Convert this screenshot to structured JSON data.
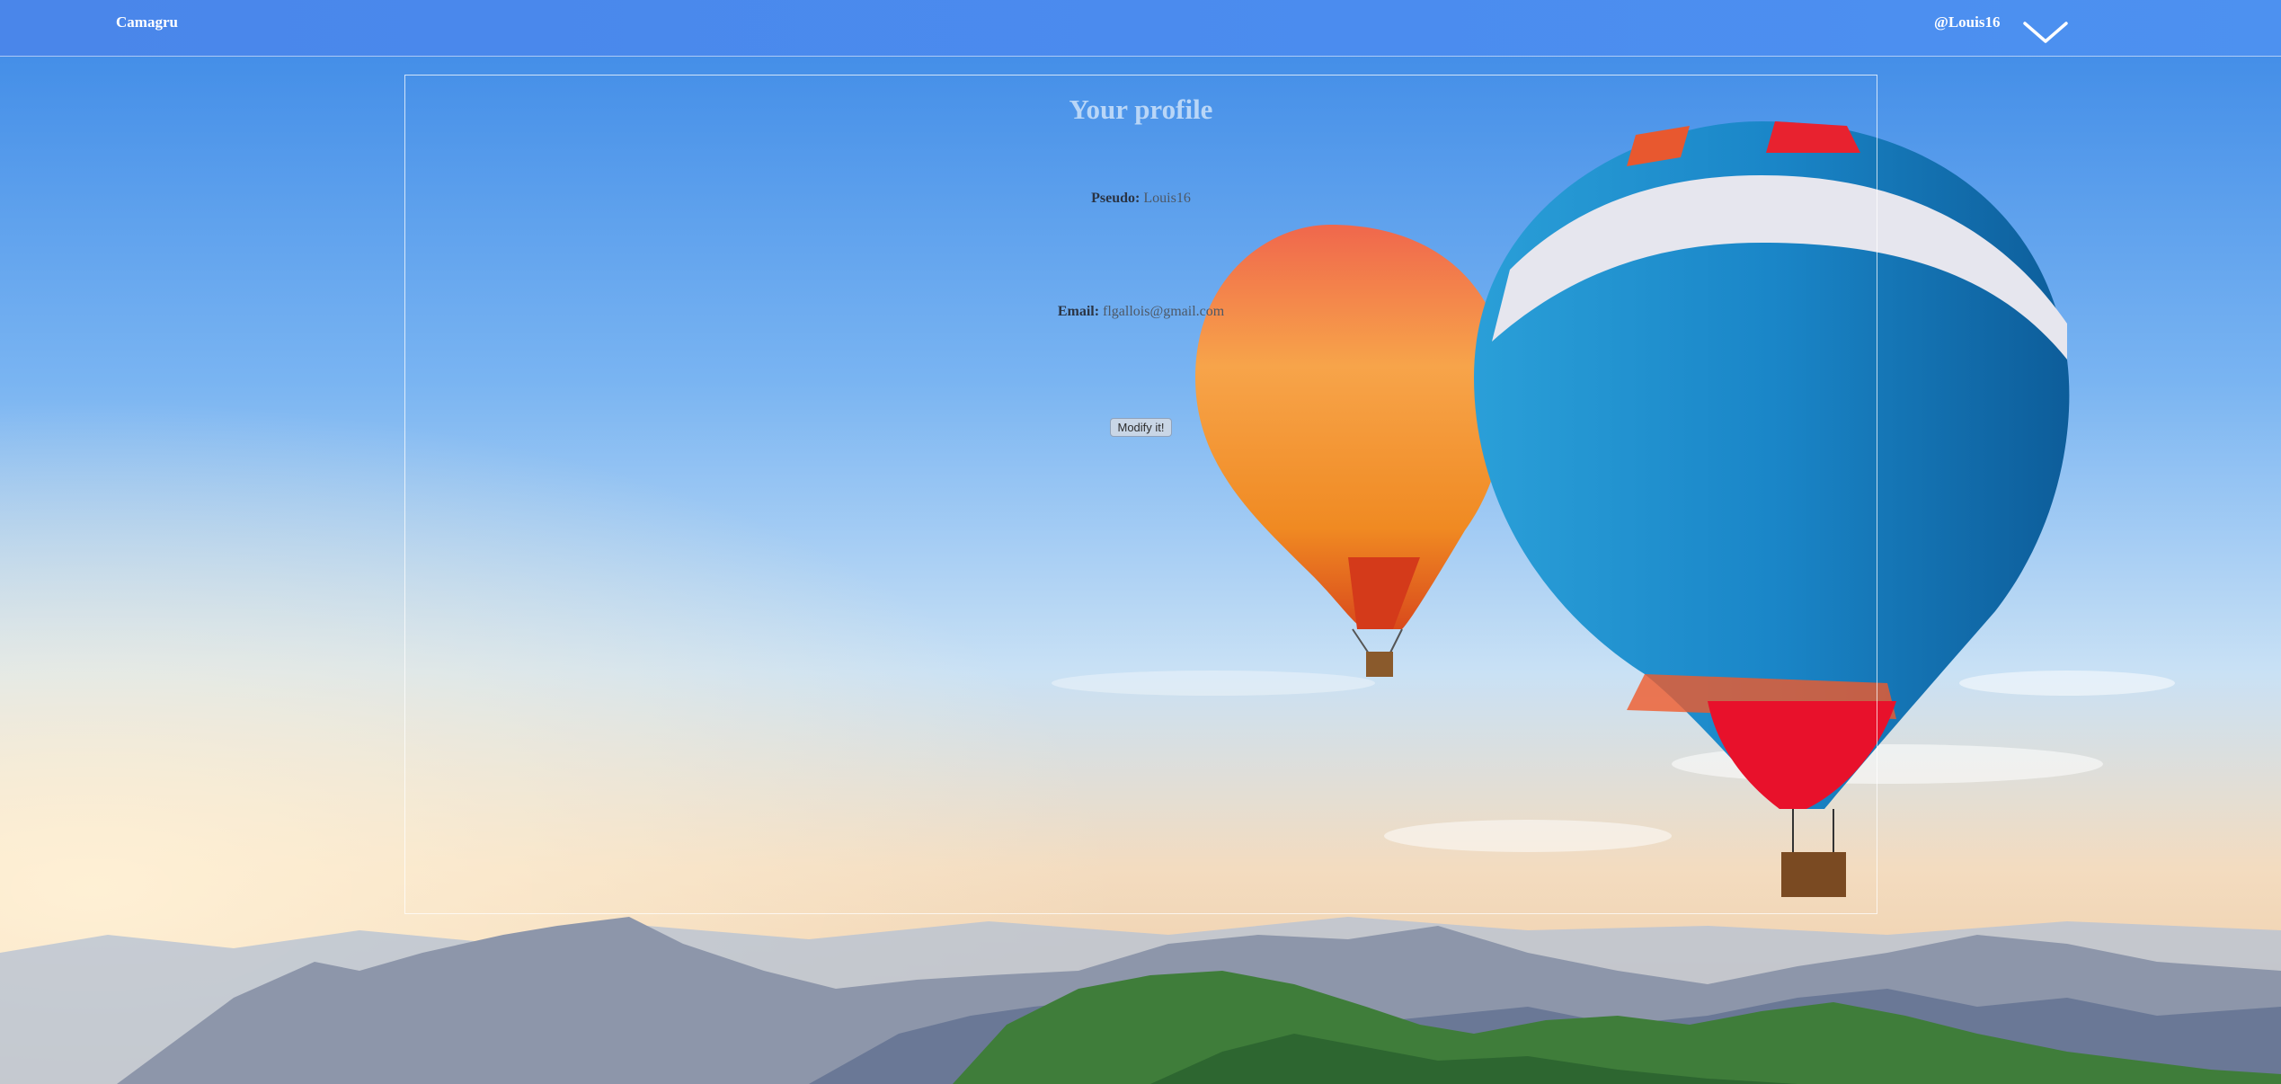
{
  "navbar": {
    "brand": "Camagru",
    "username": "@Louis16",
    "menu_icon": "chevron-down-icon"
  },
  "profile": {
    "title": "Your profile",
    "pseudo_label": "Pseudo:",
    "pseudo_value": "Louis16",
    "email_label": "Email:",
    "email_value": "flgallois@gmail.com",
    "modify_button": "Modify it!"
  },
  "background": {
    "description_icon": "hot-air-balloons-landscape",
    "sky_top": "#3f8de8",
    "sky_bottom": "#f4d9b8"
  },
  "colors": {
    "navbar": "#4a86ea",
    "title": "#b9d6f7"
  }
}
